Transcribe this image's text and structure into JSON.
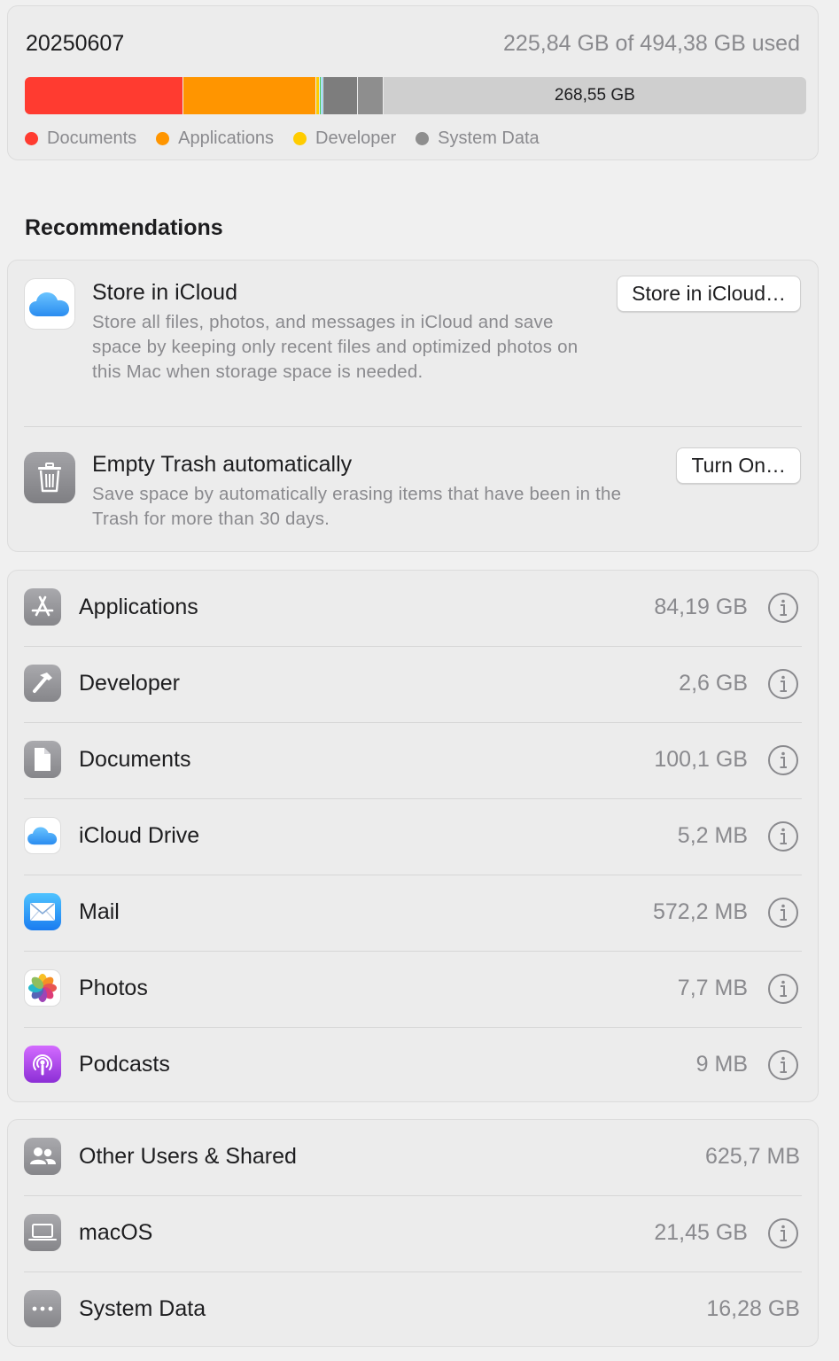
{
  "storage": {
    "volume_name": "20250607",
    "usage_text": "225,84 GB of 494,38 GB used",
    "free_label": "268,55 GB",
    "segments": [
      {
        "name": "documents",
        "color": "#ff3b30",
        "gb": 100.1
      },
      {
        "name": "applications",
        "color": "#ff9500",
        "gb": 84.19
      },
      {
        "name": "developer",
        "color": "#ffcc00",
        "gb": 2.6
      },
      {
        "name": "other-green",
        "color": "#34c759",
        "gb": 0.6
      },
      {
        "name": "other-teal",
        "color": "#5ac8fa",
        "gb": 0.6
      },
      {
        "name": "macos",
        "color": "#7d7d7d",
        "gb": 21.45
      },
      {
        "name": "system-data",
        "color": "#8e8e8e",
        "gb": 16.28
      }
    ],
    "legend": [
      {
        "label": "Documents",
        "color": "#ff3b30"
      },
      {
        "label": "Applications",
        "color": "#ff9500"
      },
      {
        "label": "Developer",
        "color": "#ffcc00"
      },
      {
        "label": "System Data",
        "color": "#8e8e8e"
      }
    ]
  },
  "recommendations": {
    "title": "Recommendations",
    "items": [
      {
        "title": "Store in iCloud",
        "description": "Store all files, photos, and messages in iCloud and save space by keeping only recent files and optimized photos on this Mac when storage space is needed.",
        "button": "Store in iCloud…",
        "icon": "icloud-icon"
      },
      {
        "title": "Empty Trash automatically",
        "description": "Save space by automatically erasing items that have been in the Trash for more than 30 days.",
        "button": "Turn On…",
        "icon": "trash-icon"
      }
    ]
  },
  "categories": [
    {
      "label": "Applications",
      "size": "84,19 GB",
      "icon": "app-store-icon"
    },
    {
      "label": "Developer",
      "size": "2,6 GB",
      "icon": "hammer-icon"
    },
    {
      "label": "Documents",
      "size": "100,1 GB",
      "icon": "document-icon"
    },
    {
      "label": "iCloud Drive",
      "size": "5,2 MB",
      "icon": "icloud-icon"
    },
    {
      "label": "Mail",
      "size": "572,2 MB",
      "icon": "mail-icon"
    },
    {
      "label": "Photos",
      "size": "7,7 MB",
      "icon": "photos-icon"
    },
    {
      "label": "Podcasts",
      "size": "9 MB",
      "icon": "podcasts-icon"
    }
  ],
  "system": [
    {
      "label": "Other Users & Shared",
      "size": "625,7 MB",
      "icon": "users-icon",
      "has_info": false
    },
    {
      "label": "macOS",
      "size": "21,45 GB",
      "icon": "laptop-icon",
      "has_info": true
    },
    {
      "label": "System Data",
      "size": "16,28 GB",
      "icon": "ellipsis-icon",
      "has_info": false
    }
  ]
}
